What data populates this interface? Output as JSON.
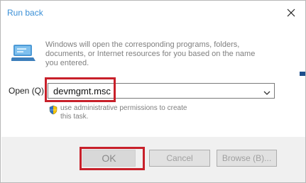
{
  "window": {
    "title": "Run back",
    "close_icon": "close-icon"
  },
  "description": "Windows will open the corresponding programs, folders, documents, or Internet resources for you based on the name you entered.",
  "open": {
    "label": "Open (Q)",
    "value": "devmgmt.msc"
  },
  "admin_note": "use administrative permissions to create this task.",
  "buttons": {
    "ok": "OK",
    "cancel": "Cancel",
    "browse": "Browse (B)..."
  },
  "colors": {
    "title": "#3a8fd6",
    "highlight": "#c8202a"
  }
}
